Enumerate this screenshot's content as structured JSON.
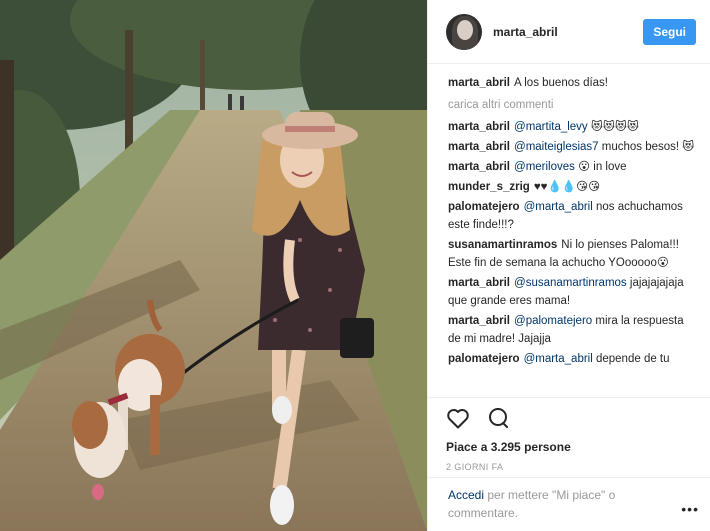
{
  "post": {
    "username": "marta_abril",
    "follow_label": "Segui"
  },
  "caption": {
    "user": "marta_abril",
    "text": "A los buenos días!"
  },
  "load_more": "carica altri commenti",
  "comments": [
    {
      "user": "marta_abril",
      "mention": "@martita_levy",
      "text": " 😻😻😻😻"
    },
    {
      "user": "marta_abril",
      "mention": "@maiteiglesias7",
      "text": " muchos besos! 😻"
    },
    {
      "user": "marta_abril",
      "mention": "@meriloves",
      "text": " 😮 in love"
    },
    {
      "user": "munder_s_zrig",
      "mention": "",
      "text": "♥♥💧💧😘😘"
    },
    {
      "user": "palomatejero",
      "mention": "@marta_abril",
      "text": " nos achuchamos este finde!!!?"
    },
    {
      "user": "susanamartinramos",
      "mention": "",
      "text": "Ni lo pienses Paloma!!! Este fin de semana la achucho YOooooo😮"
    },
    {
      "user": "marta_abril",
      "mention": "@susanamartinramos",
      "text": " jajajajajaja que grande eres mama!"
    },
    {
      "user": "marta_abril",
      "mention": "@palomatejero",
      "text": " mira la respuesta de mi madre! Jajajja"
    },
    {
      "user": "palomatejero",
      "mention": "@marta_abril",
      "text": " depende de tu"
    }
  ],
  "likes": "Piace a 3.295 persone",
  "timestamp": "2 GIORNI FA",
  "footer": {
    "login_link": "Accedi",
    "login_text": " per mettere \"Mi piace\" o commentare.",
    "more": "•••"
  },
  "icons": {
    "like": "heart-outline-icon",
    "comment": "speech-bubble-icon",
    "more": "ellipsis-icon"
  }
}
